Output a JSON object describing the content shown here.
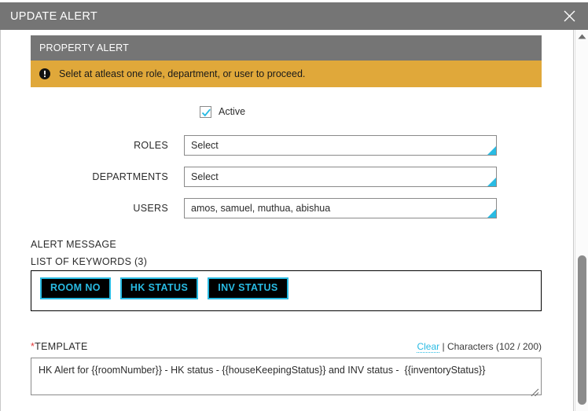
{
  "window": {
    "title": "UPDATE ALERT",
    "close_icon": "close-icon"
  },
  "panel": {
    "header_title": "PROPERTY ALERT",
    "warning": {
      "icon": "exclamation-circle-icon",
      "text": "Selet at atleast one role, department, or user to proceed.",
      "background": "#e0a83a"
    }
  },
  "form": {
    "active": {
      "label": "Active",
      "checked": true
    },
    "fields": [
      {
        "label": "ROLES",
        "value": "",
        "placeholder": "Select"
      },
      {
        "label": "DEPARTMENTS",
        "value": "",
        "placeholder": "Select"
      },
      {
        "label": "USERS",
        "value": "amos, samuel, muthua, abishua",
        "placeholder": "Select"
      }
    ]
  },
  "alert_message": {
    "title": "ALERT MESSAGE",
    "keywords_title": "LIST OF KEYWORDS (3)",
    "keywords": [
      "ROOM NO",
      "HK STATUS",
      "INV STATUS"
    ]
  },
  "template": {
    "label_required": "*",
    "label": "TEMPLATE",
    "clear_label": "Clear",
    "separator": " | ",
    "characters_label": "Characters (102 / 200)",
    "value": "HK Alert for {{roomNumber}} - HK status - {{houseKeepingStatus}} and INV status -  {{inventoryStatus}}"
  },
  "scrollbar": {
    "up_icon": "chevron-up-icon"
  },
  "colors": {
    "accent": "#29bbe3",
    "header_gray": "#757575",
    "warning": "#e0a83a",
    "required": "#e33a3a"
  }
}
